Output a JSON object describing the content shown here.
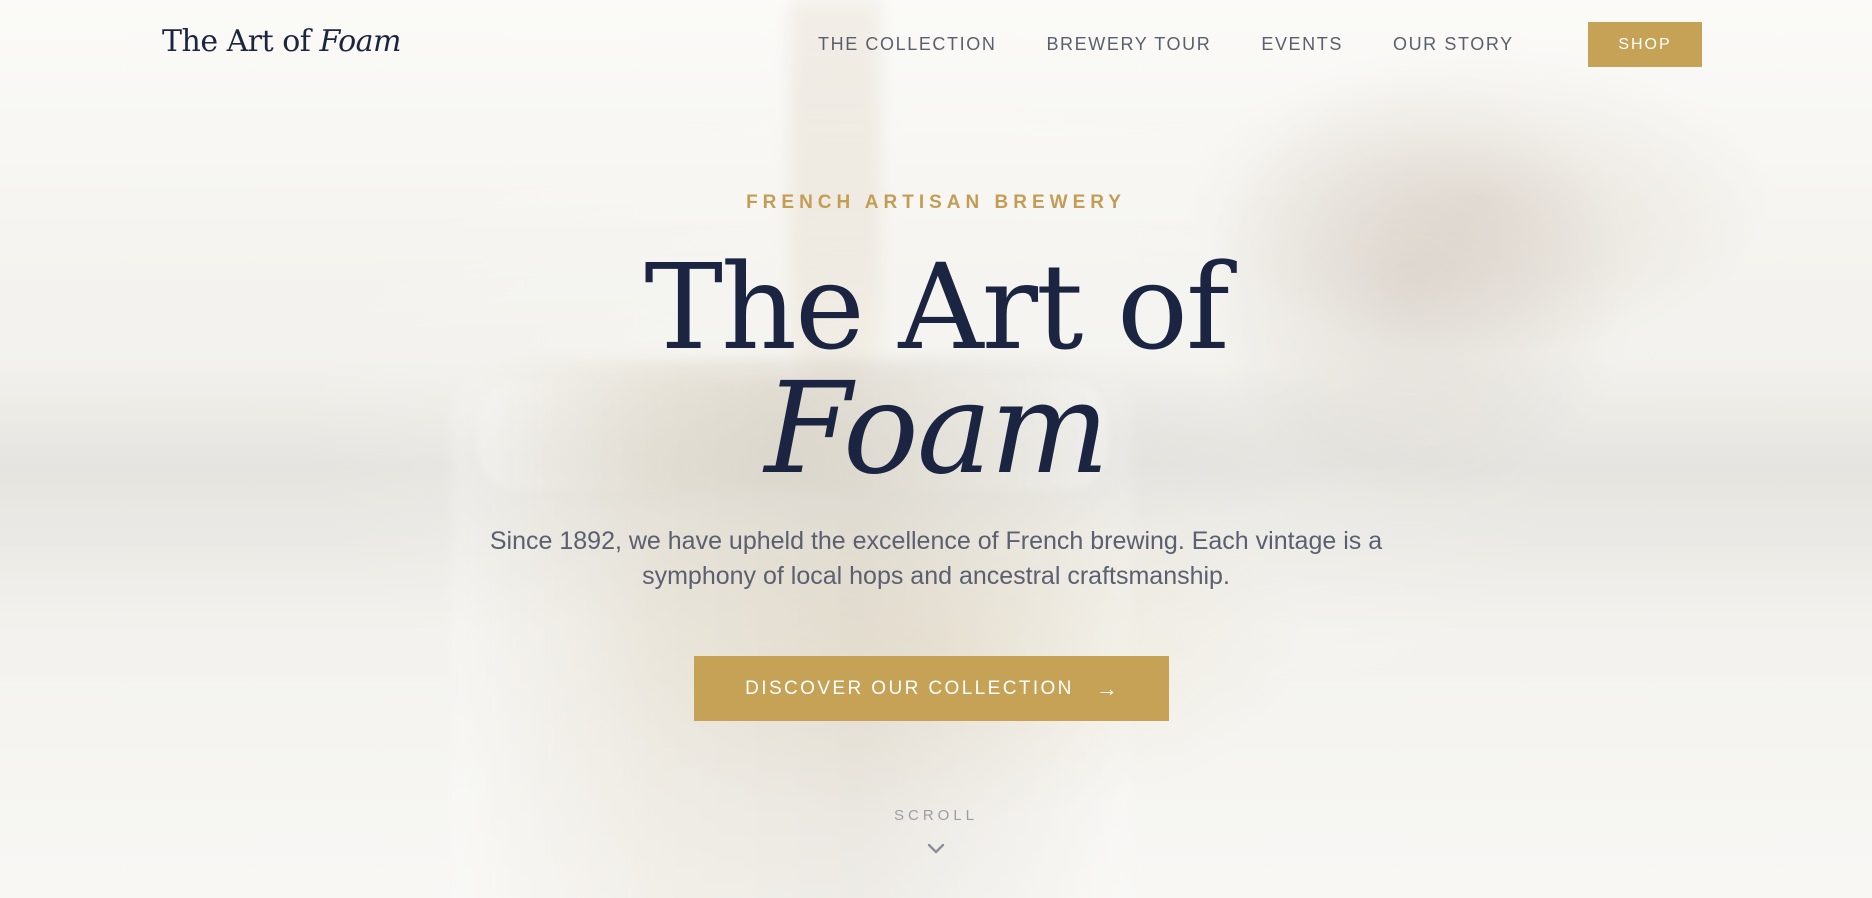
{
  "nav": {
    "logo_prefix": "The Art of",
    "logo_italic": "Foam",
    "links": [
      "THE COLLECTION",
      "BREWERY TOUR",
      "EVENTS",
      "OUR STORY"
    ],
    "shop_label": "SHOP"
  },
  "hero": {
    "eyebrow": "FRENCH ARTISAN BREWERY",
    "title_line1": "The Art of",
    "title_line2": "Foam",
    "subtitle": "Since 1892, we have upheld the excellence of French brewing. Each vintage is a symphony of local hops and ancestral craftsmanship.",
    "cta_label": "DISCOVER OUR COLLECTION",
    "cta_arrow": "→",
    "scroll_label": "SCROLL",
    "scroll_icon": "chevron-down-icon"
  },
  "colors": {
    "accent": "#c5a256",
    "navy": "#1b2441",
    "text_gray": "#5b6070"
  }
}
